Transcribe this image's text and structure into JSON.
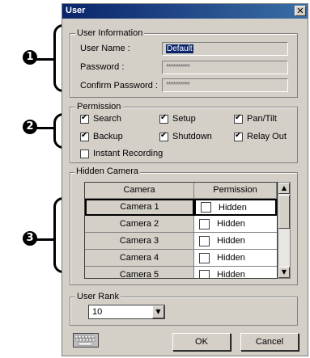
{
  "markers": {
    "one": "1",
    "two": "2",
    "three": "3"
  },
  "dialog": {
    "title": "User",
    "close_glyph": "✕"
  },
  "user_info": {
    "group_title": "User Information",
    "user_name_label": "User Name :",
    "user_name_value": "Default",
    "password_label": "Password :",
    "password_value": "**********",
    "confirm_label": "Confirm Password :",
    "confirm_value": "**********"
  },
  "permission": {
    "group_title": "Permission",
    "items": [
      {
        "label": "Search",
        "checked": true
      },
      {
        "label": "Setup",
        "checked": true
      },
      {
        "label": "Pan/Tilt",
        "checked": true
      },
      {
        "label": "Backup",
        "checked": true
      },
      {
        "label": "Shutdown",
        "checked": true
      },
      {
        "label": "Relay Out",
        "checked": true
      },
      {
        "label": "Instant Recording",
        "checked": false
      }
    ]
  },
  "hidden_camera": {
    "group_title": "Hidden Camera",
    "columns": [
      "Camera",
      "Permission"
    ],
    "rows": [
      {
        "camera": "Camera 1",
        "permission": "Hidden",
        "checked": false
      },
      {
        "camera": "Camera 2",
        "permission": "Hidden",
        "checked": false
      },
      {
        "camera": "Camera 3",
        "permission": "Hidden",
        "checked": false
      },
      {
        "camera": "Camera 4",
        "permission": "Hidden",
        "checked": false
      },
      {
        "camera": "Camera 5",
        "permission": "Hidden",
        "checked": false
      }
    ],
    "scroll_up": "▲",
    "scroll_down": "▼"
  },
  "user_rank": {
    "group_title": "User Rank",
    "selected": "10",
    "arrow": "▼"
  },
  "buttons": {
    "ok": "OK",
    "cancel": "Cancel"
  },
  "icons": {
    "keyboard": "keyboard-icon"
  },
  "colors": {
    "titlebar_start": "#0a246a",
    "titlebar_end": "#3a6ea5",
    "face": "#d4d0c8"
  }
}
